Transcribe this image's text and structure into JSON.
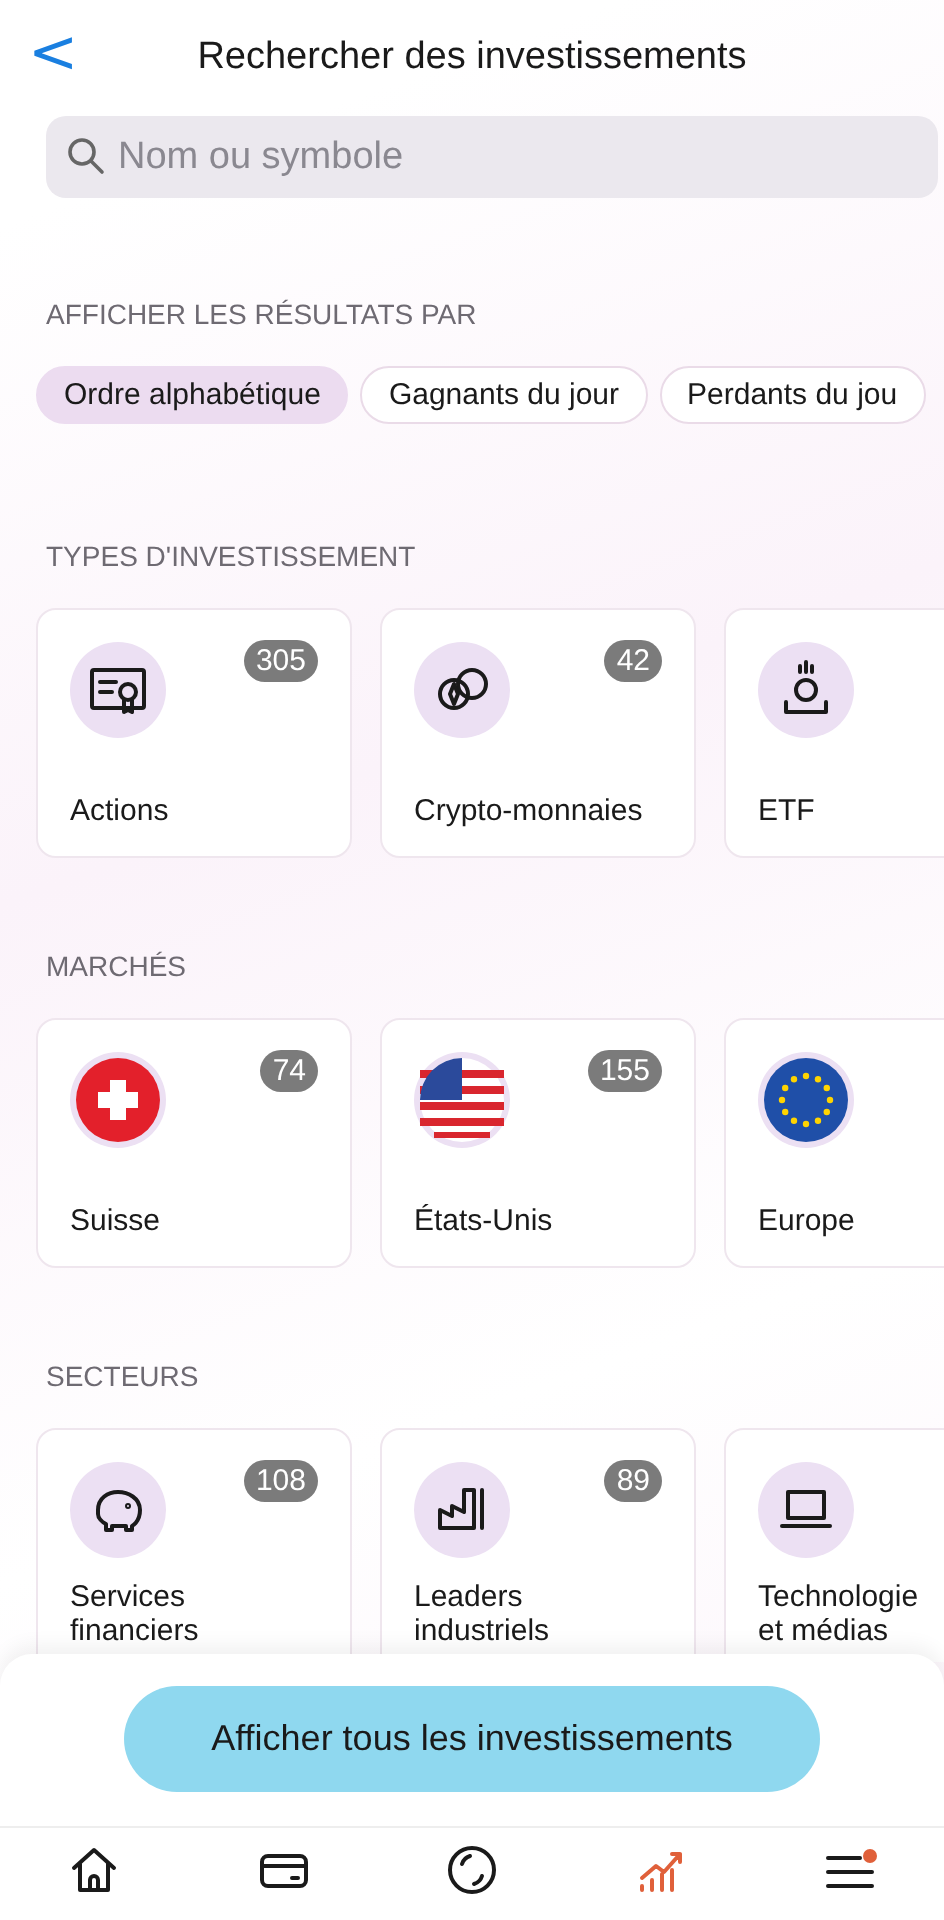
{
  "header": {
    "back": "<",
    "title": "Rechercher des investissements"
  },
  "search": {
    "placeholder": "Nom ou symbole"
  },
  "sort": {
    "heading": "AFFICHER LES RÉSULTATS PAR",
    "chips": [
      {
        "label": "Ordre alphabétique",
        "selected": true
      },
      {
        "label": "Gagnants du jour",
        "selected": false
      },
      {
        "label": "Perdants du jou",
        "selected": false
      }
    ]
  },
  "sections": [
    {
      "heading": "TYPES D'INVESTISSEMENT",
      "cards": [
        {
          "label": "Actions",
          "count": "305"
        },
        {
          "label": "Crypto-monnaies",
          "count": "42"
        },
        {
          "label": "ETF"
        }
      ]
    },
    {
      "heading": "MARCHÉS",
      "cards": [
        {
          "label": "Suisse",
          "count": "74"
        },
        {
          "label": "États-Unis",
          "count": "155"
        },
        {
          "label": "Europe"
        }
      ]
    },
    {
      "heading": "SECTEURS",
      "cards": [
        {
          "label": "Services financiers",
          "count": "108"
        },
        {
          "label": "Leaders industriels",
          "count": "89"
        },
        {
          "label": "Technologie et médias"
        }
      ]
    }
  ],
  "action": {
    "label": "Afficher tous les investissements"
  },
  "nav": [
    {
      "selected": false,
      "notification": false
    },
    {
      "selected": false,
      "notification": false
    },
    {
      "selected": false,
      "notification": false
    },
    {
      "selected": true,
      "notification": false
    },
    {
      "selected": false,
      "notification": true
    }
  ]
}
